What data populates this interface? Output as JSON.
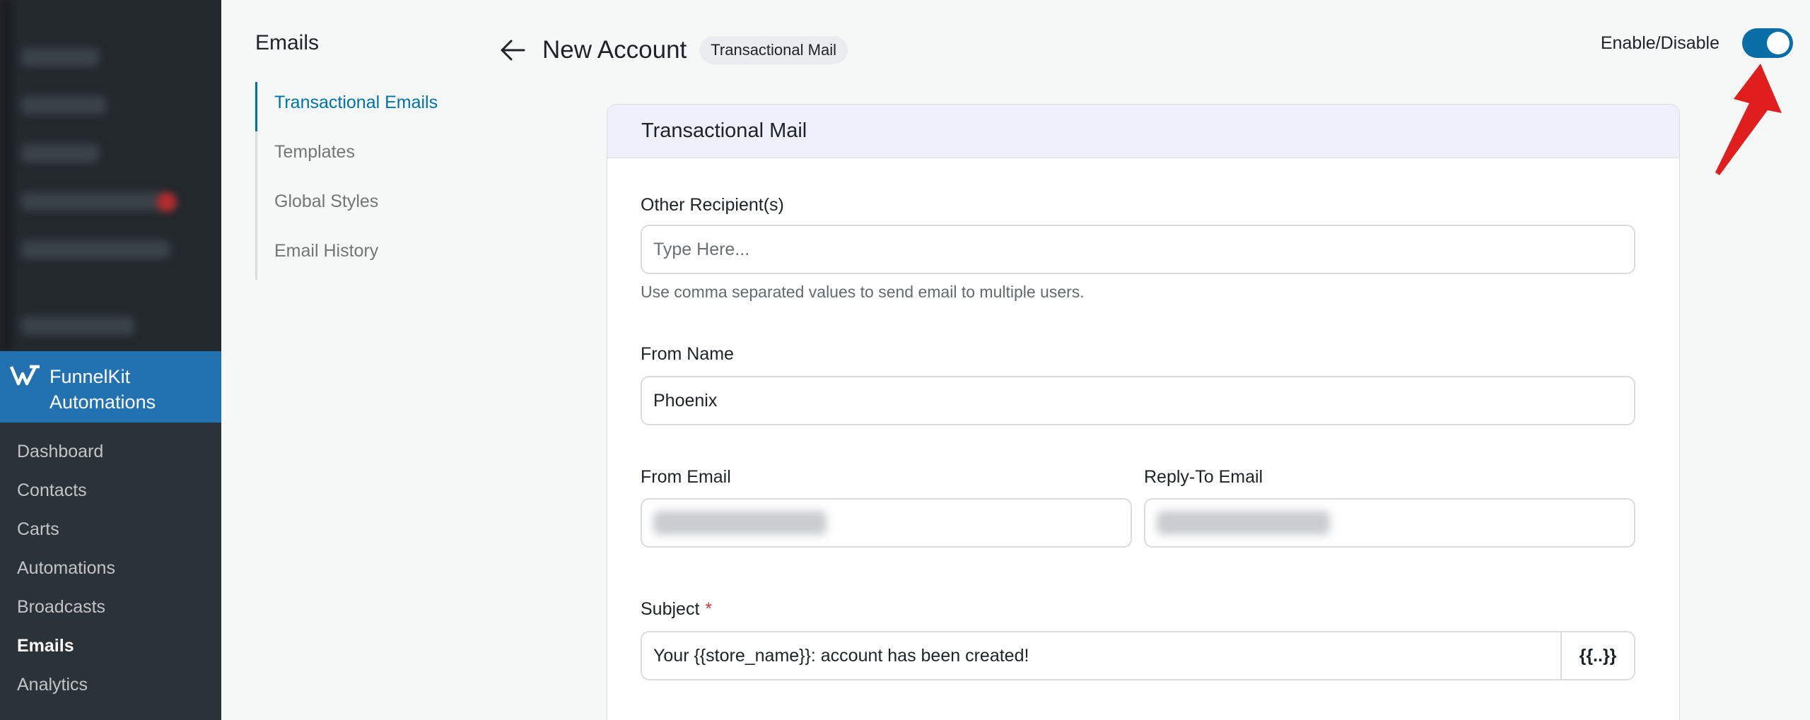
{
  "sidebar": {
    "brand_line1": "FunnelKit",
    "brand_line2": "Automations",
    "items": [
      {
        "label": "Dashboard"
      },
      {
        "label": "Contacts"
      },
      {
        "label": "Carts"
      },
      {
        "label": "Automations"
      },
      {
        "label": "Broadcasts"
      },
      {
        "label": "Emails",
        "active": true
      },
      {
        "label": "Analytics"
      }
    ]
  },
  "subnav": {
    "title": "Emails",
    "items": [
      {
        "label": "Transactional Emails",
        "active": true
      },
      {
        "label": "Templates"
      },
      {
        "label": "Global Styles"
      },
      {
        "label": "Email History"
      }
    ]
  },
  "header": {
    "title": "New Account",
    "badge": "Transactional Mail"
  },
  "toggle": {
    "label": "Enable/Disable",
    "enabled": true
  },
  "card": {
    "title": "Transactional Mail",
    "other_recipients": {
      "label": "Other Recipient(s)",
      "placeholder": "Type Here...",
      "help": "Use comma separated values to send email to multiple users."
    },
    "from_name": {
      "label": "From Name",
      "value": "Phoenix"
    },
    "from_email": {
      "label": "From Email"
    },
    "reply_to_email": {
      "label": "Reply-To Email"
    },
    "subject": {
      "label": "Subject",
      "required_mark": "*",
      "value": "Your {{store_name}}: account has been created!",
      "merge_tag_button": "{{..}}"
    }
  },
  "colors": {
    "accent": "#0073aa",
    "brand_bar": "#2271b1",
    "toggle_on": "#0a6ea6",
    "annotation": "#e01e1e"
  }
}
